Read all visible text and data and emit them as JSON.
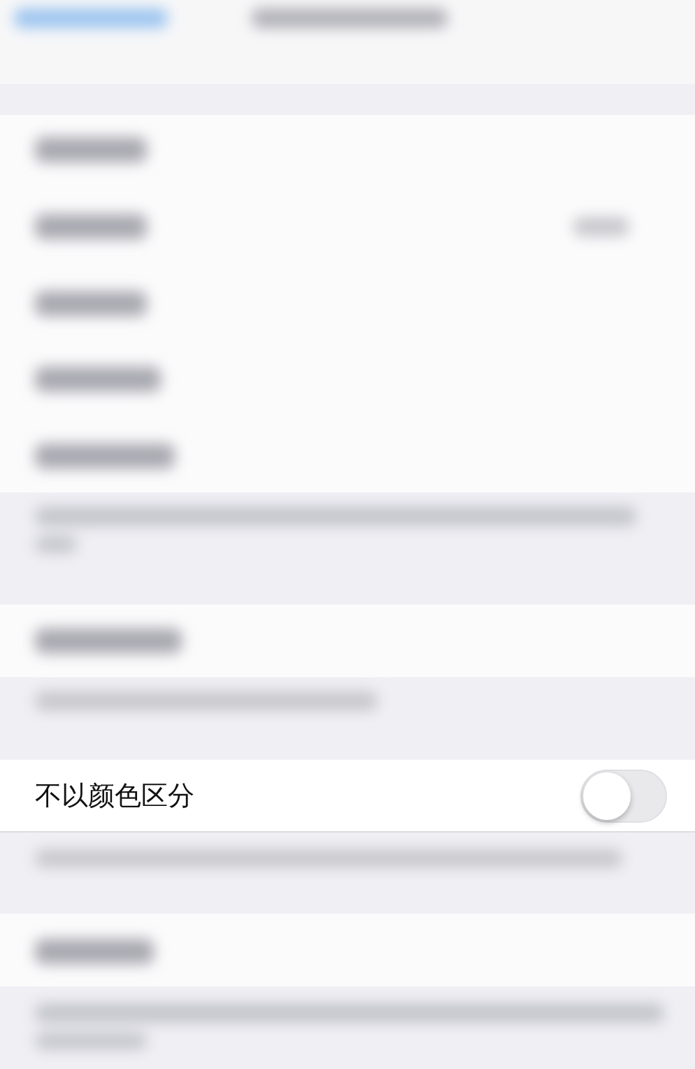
{
  "setting": {
    "label": "不以颜色区分",
    "on": false
  }
}
